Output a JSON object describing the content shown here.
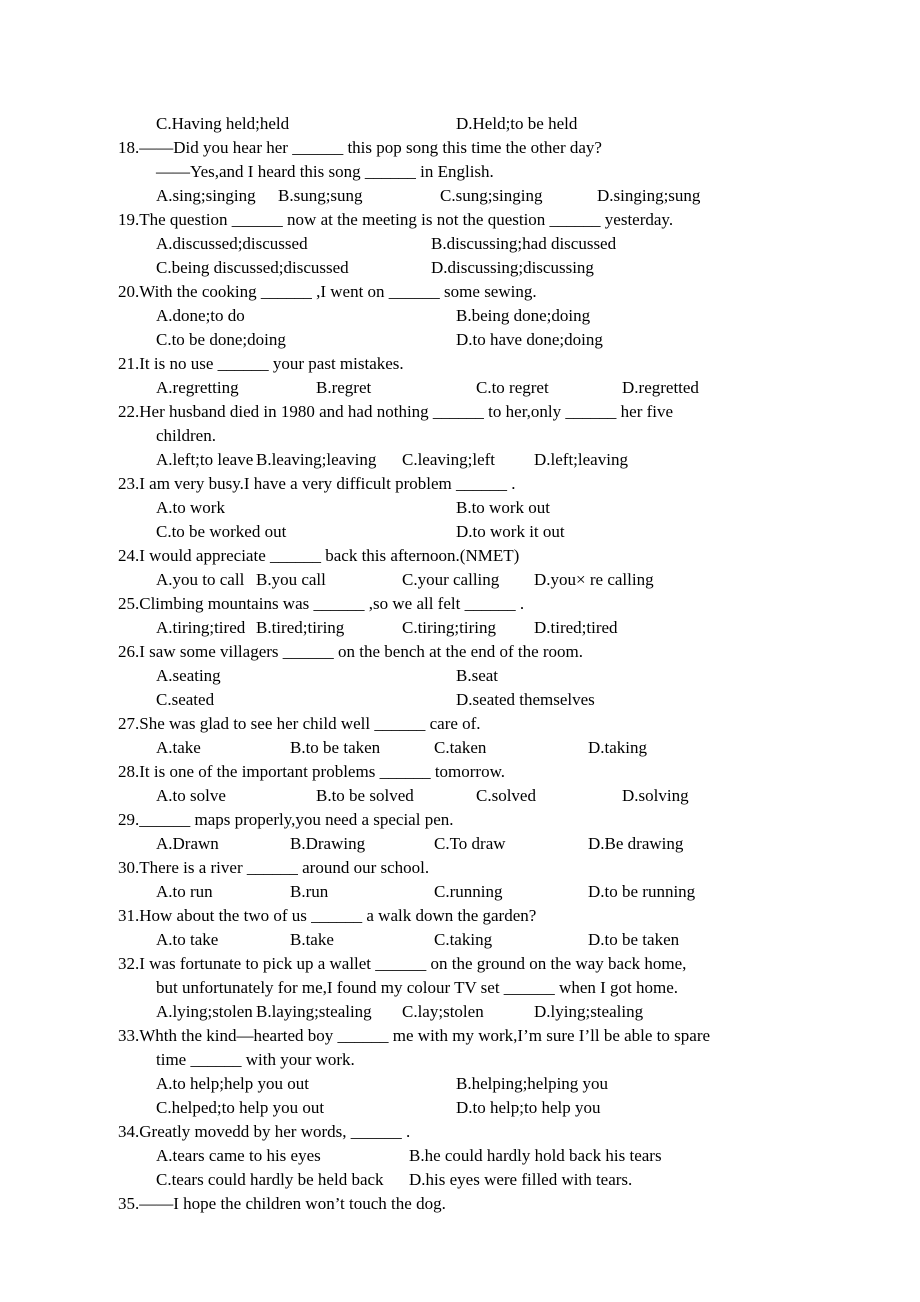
{
  "document": {
    "type": "grammar-multiple-choice-worksheet",
    "language": "English",
    "blank": "______",
    "long_blank": "_______",
    "dash": "——",
    "page_background": "#ffffff",
    "text_color": "#000000"
  },
  "items": [
    {
      "id": "q17-options-tail",
      "kind": "options-two",
      "rows": [
        {
          "a": "C.Having held;held",
          "b": "D.Held;to be held"
        }
      ]
    },
    {
      "id": "q18",
      "number": "18.",
      "kind": "question",
      "stem_lines": [
        "18.——Did you hear her ______ this pop song this time the other day?",
        "——Yes,and I heard this song ______ in English."
      ],
      "options_layout": "four",
      "options": [
        "A.sing;singing",
        "B.sung;sung",
        "C.sung;singing",
        "D.singing;sung"
      ]
    },
    {
      "id": "q19",
      "number": "19.",
      "kind": "question",
      "stem_lines": [
        "19.The question ______ now at the meeting is not the question ______ yesterday."
      ],
      "options_layout": "two",
      "options_rows": [
        {
          "a": "A.discussed;discussed",
          "b": "B.discussing;had discussed"
        },
        {
          "a": "C.being discussed;discussed",
          "b": "D.discussing;discussing"
        }
      ]
    },
    {
      "id": "q20",
      "number": "20.",
      "kind": "question",
      "stem_lines": [
        "20.With the cooking ______ ,I went on ______ some sewing."
      ],
      "options_layout": "two",
      "options_rows": [
        {
          "a": "A.done;to do",
          "b": "B.being done;doing"
        },
        {
          "a": "C.to be done;doing",
          "b": "D.to have done;doing"
        }
      ]
    },
    {
      "id": "q21",
      "number": "21.",
      "kind": "question",
      "stem_lines": [
        "21.It is no use ______ your past mistakes."
      ],
      "options_layout": "four",
      "options": [
        "A.regretting",
        "B.regret",
        "C.to regret",
        "D.regretted"
      ]
    },
    {
      "id": "q22",
      "number": "22.",
      "kind": "question",
      "stem_lines": [
        "22.Her husband died in 1980 and had nothing ______ to her,only ______ her five",
        "children."
      ],
      "options_layout": "four",
      "options": [
        "A.left;to leave",
        "B.leaving;leaving",
        "C.leaving;left",
        "D.left;leaving"
      ]
    },
    {
      "id": "q23",
      "number": "23.",
      "kind": "question",
      "stem_lines": [
        "23.I am very busy.I have a very difficult problem ______ ."
      ],
      "options_layout": "two",
      "options_rows": [
        {
          "a": "A.to work",
          "b": "B.to work out"
        },
        {
          "a": "C.to be worked out",
          "b": "D.to work it out"
        }
      ]
    },
    {
      "id": "q24",
      "number": "24.",
      "kind": "question",
      "stem_lines": [
        "24.I would appreciate ______ back this afternoon.(NMET)"
      ],
      "options_layout": "four",
      "options": [
        "A.you to call",
        "B.you call",
        "C.your calling",
        "D.you× re calling"
      ]
    },
    {
      "id": "q25",
      "number": "25.",
      "kind": "question",
      "stem_lines": [
        "25.Climbing mountains was ______ ,so we all felt ______ ."
      ],
      "options_layout": "four",
      "options": [
        "A.tiring;tired",
        "B.tired;tiring",
        "C.tiring;tiring",
        "D.tired;tired"
      ]
    },
    {
      "id": "q26",
      "number": "26.",
      "kind": "question",
      "stem_lines": [
        "26.I saw some villagers ______ on the bench at the end of the room."
      ],
      "options_layout": "two",
      "options_rows": [
        {
          "a": "A.seating",
          "b": "B.seat"
        },
        {
          "a": "C.seated",
          "b": "D.seated themselves"
        }
      ]
    },
    {
      "id": "q27",
      "number": "27.",
      "kind": "question",
      "stem_lines": [
        "27.She was glad to see her child well ______ care of."
      ],
      "options_layout": "four",
      "options": [
        "A.take",
        "B.to be taken",
        "C.taken",
        "D.taking"
      ]
    },
    {
      "id": "q28",
      "number": "28.",
      "kind": "question",
      "stem_lines": [
        "28.It is one of the important problems ______ tomorrow."
      ],
      "options_layout": "four",
      "options": [
        "A.to solve",
        "B.to be solved",
        "C.solved",
        "D.solving"
      ]
    },
    {
      "id": "q29",
      "number": "29.",
      "kind": "question",
      "stem_lines": [
        "29.______ maps properly,you need a special pen."
      ],
      "options_layout": "four",
      "options": [
        "A.Drawn",
        "B.Drawing",
        "C.To draw",
        "D.Be drawing"
      ]
    },
    {
      "id": "q30",
      "number": "30.",
      "kind": "question",
      "stem_lines": [
        "30.There is a river ______ around our school."
      ],
      "options_layout": "four",
      "options": [
        "A.to run",
        "B.run",
        "C.running",
        "D.to be running"
      ]
    },
    {
      "id": "q31",
      "number": "31.",
      "kind": "question",
      "stem_lines": [
        "31.How about the two of us ______ a walk down the garden?"
      ],
      "options_layout": "four",
      "options": [
        "A.to take",
        "B.take",
        "C.taking",
        "D.to be taken"
      ]
    },
    {
      "id": "q32",
      "number": "32.",
      "kind": "question",
      "stem_lines": [
        "32.I was fortunate to pick up a wallet ______ on the ground on the way back home,",
        "but unfortunately for me,I found my colour TV set ______ when I got home."
      ],
      "options_layout": "four",
      "options": [
        "A.lying;stolen",
        "B.laying;stealing",
        "C.lay;stolen",
        "D.lying;stealing"
      ]
    },
    {
      "id": "q33",
      "number": "33.",
      "kind": "question",
      "stem_lines": [
        "33.Whth the kind—hearted boy ______ me with my work,I’m sure I’ll be able to spare",
        "time ______ with your work."
      ],
      "options_layout": "two",
      "options_rows": [
        {
          "a": "A.to help;help you out",
          "b": "B.helping;helping you"
        },
        {
          "a": "C.helped;to help you out",
          "b": "D.to help;to help you"
        }
      ]
    },
    {
      "id": "q34",
      "number": "34.",
      "kind": "question",
      "stem_lines": [
        "34.Greatly movedd by her words, ______ ."
      ],
      "options_layout": "two",
      "options_rows": [
        {
          "a": "A.tears came to his eyes",
          "b": "B.he could hardly hold back his tears"
        },
        {
          "a": "C.tears could hardly be held back",
          "b": "D.his eyes were filled with tears."
        }
      ]
    },
    {
      "id": "q35",
      "number": "35.",
      "kind": "question",
      "stem_lines": [
        "35.——I hope the children won’t touch the dog."
      ],
      "options_layout": "none",
      "options": []
    }
  ]
}
